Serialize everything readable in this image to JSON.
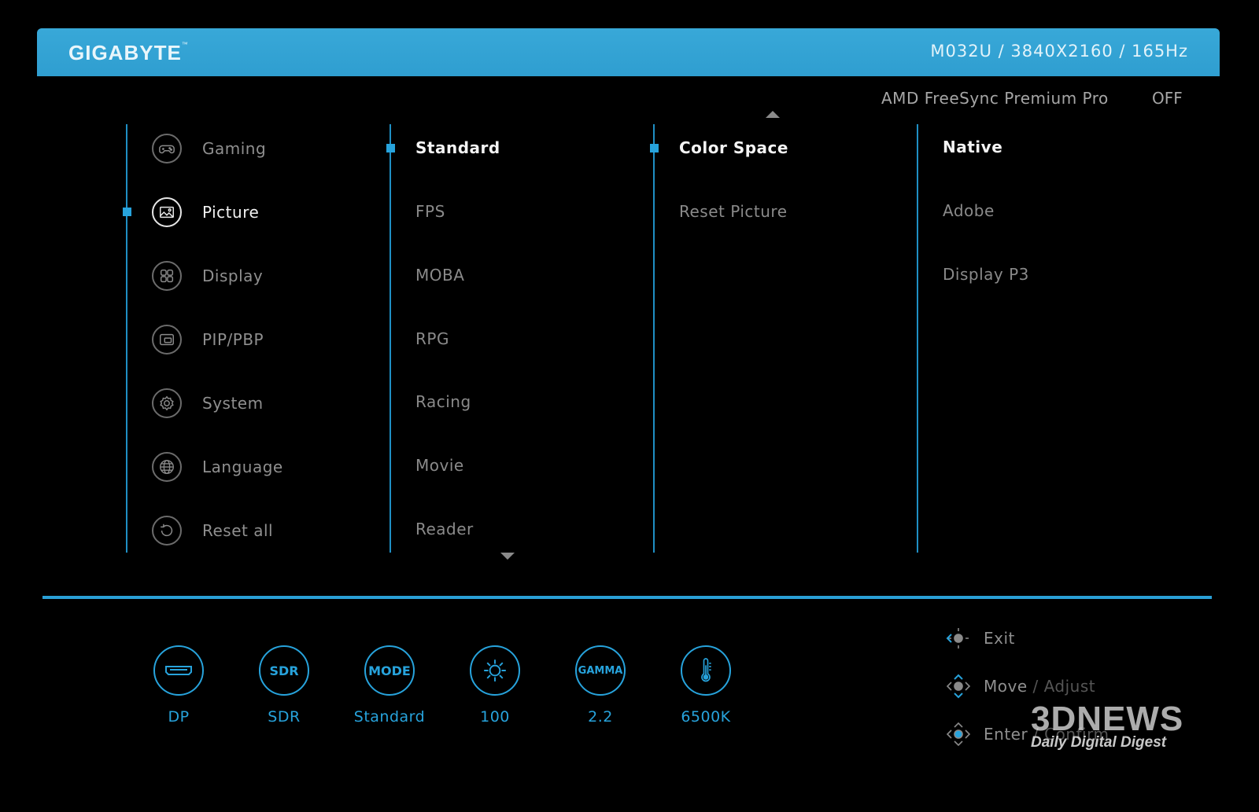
{
  "header": {
    "brand": "GIGABYTE",
    "brand_tm": "™",
    "model_info": "M032U  /  3840X2160  /  165Hz",
    "bar_color": "#2f9ed0"
  },
  "freesync": {
    "label": "AMD FreeSync Premium Pro",
    "value": "OFF"
  },
  "main_menu": {
    "items": [
      {
        "label": "Gaming",
        "icon": "gamepad-icon"
      },
      {
        "label": "Picture",
        "icon": "picture-icon",
        "active": true
      },
      {
        "label": "Display",
        "icon": "display-grid-icon"
      },
      {
        "label": "PIP/PBP",
        "icon": "pip-icon"
      },
      {
        "label": "System",
        "icon": "gear-icon"
      },
      {
        "label": "Language",
        "icon": "globe-icon"
      },
      {
        "label": "Reset all",
        "icon": "reset-icon"
      }
    ]
  },
  "picture_modes": {
    "items": [
      "Standard",
      "FPS",
      "MOBA",
      "RPG",
      "Racing",
      "Movie",
      "Reader"
    ],
    "active": "Standard"
  },
  "picture_settings": {
    "items": [
      "Color Space",
      "Reset Picture"
    ],
    "active": "Color Space"
  },
  "color_space_options": {
    "items": [
      "Native",
      "Adobe",
      "Display P3"
    ],
    "active": "Native"
  },
  "status_bar": {
    "items": [
      {
        "icon": "input-port-icon",
        "value": "DP"
      },
      {
        "icon": "sdr-icon",
        "icon_text": "SDR",
        "value": "SDR"
      },
      {
        "icon": "mode-icon",
        "icon_text": "MODE",
        "value": "Standard"
      },
      {
        "icon": "brightness-icon",
        "value": "100"
      },
      {
        "icon": "gamma-icon",
        "icon_text": "GAMMA",
        "value": "2.2"
      },
      {
        "icon": "thermometer-icon",
        "value": "6500K"
      }
    ],
    "accent_color": "#27a3dc"
  },
  "nav_hints": {
    "exit": "Exit",
    "move": "Move",
    "adjust": " / Adjust",
    "enter": "Enter",
    "confirm": " / Confirm"
  },
  "watermark": {
    "logo": "3DNEWS",
    "tagline": "Daily Digital Digest"
  }
}
